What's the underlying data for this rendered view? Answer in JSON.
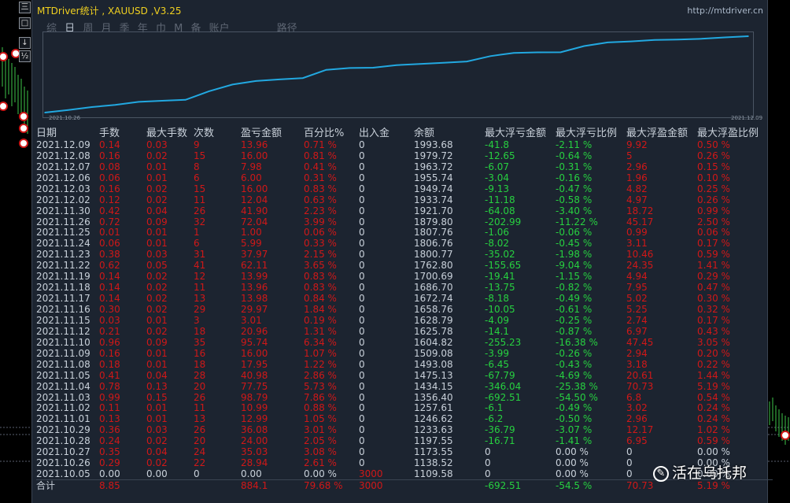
{
  "header": {
    "title": "MTDriver统计 , XAUUSD ,V3.25",
    "url": "http://mtdriver.cn",
    "tabs": [
      {
        "label": "综",
        "active": false
      },
      {
        "label": "日",
        "active": true
      },
      {
        "label": "周",
        "active": false
      },
      {
        "label": "月",
        "active": false
      },
      {
        "label": "季",
        "active": false
      },
      {
        "label": "年",
        "active": false
      },
      {
        "label": "巾",
        "active": false
      },
      {
        "label": "M",
        "active": false
      },
      {
        "label": "备",
        "active": false
      },
      {
        "label": "账户",
        "active": false
      }
    ],
    "path_label": "路径"
  },
  "side_buttons": [
    "三",
    "□",
    "↓",
    "½",
    "?"
  ],
  "equity_chart": {
    "start_date": "2021.10.26",
    "end_date": "2021.12.09",
    "line_color": "#22a8e0"
  },
  "chart_data": {
    "type": "line",
    "x": [
      "2021.10.05",
      "2021.10.26",
      "2021.10.27",
      "2021.10.28",
      "2021.10.29",
      "2021.11.01",
      "2021.11.02",
      "2021.11.03",
      "2021.11.04",
      "2021.11.05",
      "2021.11.08",
      "2021.11.09",
      "2021.11.10",
      "2021.11.12",
      "2021.11.15",
      "2021.11.16",
      "2021.11.17",
      "2021.11.18",
      "2021.11.19",
      "2021.11.22",
      "2021.11.23",
      "2021.11.24",
      "2021.11.25",
      "2021.11.26",
      "2021.11.30",
      "2021.12.02",
      "2021.12.03",
      "2021.12.06",
      "2021.12.07",
      "2021.12.08",
      "2021.12.09"
    ],
    "series": [
      {
        "values": [
          1109.58,
          1138.52,
          1173.55,
          1197.55,
          1233.63,
          1246.62,
          1257.61,
          1356.4,
          1434.15,
          1475.13,
          1493.08,
          1509.08,
          1604.82,
          1625.78,
          1628.79,
          1658.76,
          1672.74,
          1686.7,
          1700.69,
          1762.8,
          1800.77,
          1806.76,
          1807.76,
          1879.8,
          1921.7,
          1933.74,
          1949.74,
          1955.74,
          1963.72,
          1979.72,
          1993.68
        ]
      }
    ],
    "ylim": [
      1109.58,
      1993.68
    ],
    "grid": false
  },
  "table": {
    "columns": [
      "日期",
      "手数",
      "最大手数",
      "次数",
      "盈亏金额",
      "百分比%",
      "出入金",
      "余额",
      "最大浮亏金额",
      "最大浮亏比例",
      "最大浮盈金额",
      "最大浮盈比例"
    ],
    "rows": [
      [
        "2021.12.09",
        "0.14",
        "0.03",
        "9",
        "13.96",
        "0.71 %",
        "0",
        "1993.68",
        "-41.8",
        "-2.11 %",
        "9.92",
        "0.50 %"
      ],
      [
        "2021.12.08",
        "0.16",
        "0.02",
        "15",
        "16.00",
        "0.81 %",
        "0",
        "1979.72",
        "-12.65",
        "-0.64 %",
        "5",
        "0.26 %"
      ],
      [
        "2021.12.07",
        "0.08",
        "0.01",
        "8",
        "7.98",
        "0.41 %",
        "0",
        "1963.72",
        "-6.07",
        "-0.31 %",
        "2.96",
        "0.15 %"
      ],
      [
        "2021.12.06",
        "0.06",
        "0.01",
        "6",
        "6.00",
        "0.31 %",
        "0",
        "1955.74",
        "-3.04",
        "-0.16 %",
        "1.96",
        "0.10 %"
      ],
      [
        "2021.12.03",
        "0.16",
        "0.02",
        "15",
        "16.00",
        "0.83 %",
        "0",
        "1949.74",
        "-9.13",
        "-0.47 %",
        "4.82",
        "0.25 %"
      ],
      [
        "2021.12.02",
        "0.12",
        "0.02",
        "11",
        "12.04",
        "0.63 %",
        "0",
        "1933.74",
        "-11.18",
        "-0.58 %",
        "4.97",
        "0.26 %"
      ],
      [
        "2021.11.30",
        "0.42",
        "0.04",
        "26",
        "41.90",
        "2.23 %",
        "0",
        "1921.70",
        "-64.08",
        "-3.40 %",
        "18.72",
        "0.99 %"
      ],
      [
        "2021.11.26",
        "0.72",
        "0.09",
        "32",
        "72.04",
        "3.99 %",
        "0",
        "1879.80",
        "-202.99",
        "-11.22 %",
        "45.17",
        "2.50 %"
      ],
      [
        "2021.11.25",
        "0.01",
        "0.01",
        "1",
        "1.00",
        "0.06 %",
        "0",
        "1807.76",
        "-1.06",
        "-0.06 %",
        "0.99",
        "0.06 %"
      ],
      [
        "2021.11.24",
        "0.06",
        "0.01",
        "6",
        "5.99",
        "0.33 %",
        "0",
        "1806.76",
        "-8.02",
        "-0.45 %",
        "3.11",
        "0.17 %"
      ],
      [
        "2021.11.23",
        "0.38",
        "0.03",
        "31",
        "37.97",
        "2.15 %",
        "0",
        "1800.77",
        "-35.02",
        "-1.98 %",
        "10.46",
        "0.59 %"
      ],
      [
        "2021.11.22",
        "0.62",
        "0.05",
        "41",
        "62.11",
        "3.65 %",
        "0",
        "1762.80",
        "-155.65",
        "-9.04 %",
        "24.35",
        "1.41 %"
      ],
      [
        "2021.11.19",
        "0.14",
        "0.02",
        "12",
        "13.99",
        "0.83 %",
        "0",
        "1700.69",
        "-19.41",
        "-1.15 %",
        "4.94",
        "0.29 %"
      ],
      [
        "2021.11.18",
        "0.14",
        "0.02",
        "11",
        "13.96",
        "0.83 %",
        "0",
        "1686.70",
        "-13.75",
        "-0.82 %",
        "7.95",
        "0.47 %"
      ],
      [
        "2021.11.17",
        "0.14",
        "0.02",
        "13",
        "13.98",
        "0.84 %",
        "0",
        "1672.74",
        "-8.18",
        "-0.49 %",
        "5.02",
        "0.30 %"
      ],
      [
        "2021.11.16",
        "0.30",
        "0.02",
        "29",
        "29.97",
        "1.84 %",
        "0",
        "1658.76",
        "-10.05",
        "-0.61 %",
        "5.25",
        "0.32 %"
      ],
      [
        "2021.11.15",
        "0.03",
        "0.01",
        "3",
        "3.01",
        "0.19 %",
        "0",
        "1628.79",
        "-4.09",
        "-0.25 %",
        "2.74",
        "0.17 %"
      ],
      [
        "2021.11.12",
        "0.21",
        "0.02",
        "18",
        "20.96",
        "1.31 %",
        "0",
        "1625.78",
        "-14.1",
        "-0.87 %",
        "6.97",
        "0.43 %"
      ],
      [
        "2021.11.10",
        "0.96",
        "0.09",
        "35",
        "95.74",
        "6.34 %",
        "0",
        "1604.82",
        "-255.23",
        "-16.38 %",
        "47.45",
        "3.05 %"
      ],
      [
        "2021.11.09",
        "0.16",
        "0.01",
        "16",
        "16.00",
        "1.07 %",
        "0",
        "1509.08",
        "-3.99",
        "-0.26 %",
        "2.94",
        "0.20 %"
      ],
      [
        "2021.11.08",
        "0.18",
        "0.01",
        "18",
        "17.95",
        "1.22 %",
        "0",
        "1493.08",
        "-6.45",
        "-0.43 %",
        "3.18",
        "0.22 %"
      ],
      [
        "2021.11.05",
        "0.41",
        "0.04",
        "28",
        "40.98",
        "2.86 %",
        "0",
        "1475.13",
        "-67.79",
        "-4.69 %",
        "20.61",
        "1.44 %"
      ],
      [
        "2021.11.04",
        "0.78",
        "0.13",
        "20",
        "77.75",
        "5.73 %",
        "0",
        "1434.15",
        "-346.04",
        "-25.38 %",
        "70.73",
        "5.19 %"
      ],
      [
        "2021.11.03",
        "0.99",
        "0.15",
        "26",
        "98.79",
        "7.86 %",
        "0",
        "1356.40",
        "-692.51",
        "-54.50 %",
        "6.8",
        "0.54 %"
      ],
      [
        "2021.11.02",
        "0.11",
        "0.01",
        "11",
        "10.99",
        "0.88 %",
        "0",
        "1257.61",
        "-6.1",
        "-0.49 %",
        "3.02",
        "0.24 %"
      ],
      [
        "2021.11.01",
        "0.13",
        "0.01",
        "13",
        "12.99",
        "1.05 %",
        "0",
        "1246.62",
        "-6.2",
        "-0.50 %",
        "2.96",
        "0.24 %"
      ],
      [
        "2021.10.29",
        "0.36",
        "0.03",
        "26",
        "36.08",
        "3.01 %",
        "0",
        "1233.63",
        "-36.79",
        "-3.07 %",
        "12.17",
        "1.02 %"
      ],
      [
        "2021.10.28",
        "0.24",
        "0.02",
        "20",
        "24.00",
        "2.05 %",
        "0",
        "1197.55",
        "-16.71",
        "-1.41 %",
        "6.95",
        "0.59 %"
      ],
      [
        "2021.10.27",
        "0.35",
        "0.04",
        "24",
        "35.03",
        "3.08 %",
        "0",
        "1173.55",
        "0",
        "0.00 %",
        "0",
        "0.00 %"
      ],
      [
        "2021.10.26",
        "0.29",
        "0.02",
        "22",
        "28.94",
        "2.61 %",
        "0",
        "1138.52",
        "0",
        "0.00 %",
        "0",
        "0.00 %"
      ],
      [
        "2021.10.05",
        "0.00",
        "0.00",
        "0",
        "0.00",
        "0.00 %",
        "3000",
        "1109.58",
        "0",
        "0.00 %",
        "0",
        "0.00 %"
      ]
    ],
    "footer": [
      "合计",
      "8.85",
      "",
      "",
      "884.1",
      "79.68 %",
      "3000",
      "",
      "-692.51",
      "-54.5 %",
      "70.73",
      "5.19 %"
    ]
  },
  "watermark": {
    "text": "活在乌托邦",
    "icon": "zhihu-icon"
  },
  "colors": {
    "panel_bg": "#1c2430",
    "title": "#f0d020",
    "positive": "#d01818",
    "negative": "#27d040",
    "text": "#c9d1da"
  }
}
